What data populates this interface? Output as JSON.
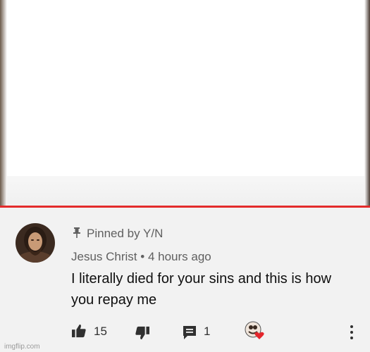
{
  "comment": {
    "pinned_label": "Pinned by Y/N",
    "author": "Jesus Christ",
    "separator": "•",
    "time": "4 hours ago",
    "text": "I literally died for your sins and this is how you repay me",
    "likes": "15",
    "replies": "1"
  },
  "watermark": "imgflip.com",
  "colors": {
    "panel_bg": "#f2f2f2",
    "text_primary": "#0f0f0f",
    "text_secondary": "#606060",
    "heart": "#e4252b",
    "progress_red": "#e32b2b"
  },
  "icons": [
    "pin-icon",
    "thumbs-up-icon",
    "thumbs-down-icon",
    "reply-icon",
    "creator-heart-icon",
    "more-options-icon"
  ]
}
